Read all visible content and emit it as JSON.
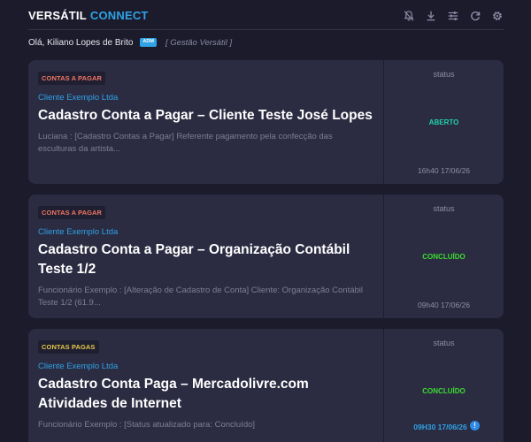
{
  "brand": {
    "part1": "VERSÁTIL",
    "part2": "CONNECT",
    "accent": "#2fa3e6"
  },
  "toolbar": {
    "icons": [
      "bell-off-icon",
      "download-icon",
      "sliders-icon",
      "refresh-icon",
      "gear-icon"
    ]
  },
  "user": {
    "greeting": "Olá, Kiliano Lopes de Brito",
    "role_badge": "ADM",
    "organization": "[ Gestão Versátil ]"
  },
  "cards": [
    {
      "tag": "CONTAS A PAGAR",
      "client": "Cliente Exemplo Ltda",
      "title": "Cadastro Conta a Pagar – Cliente Teste José Lopes",
      "description": "Luciana : [Cadastro Contas a Pagar] Referente pagamento pela confecção das esculturas da artista...",
      "status_label": "status",
      "status": "ABERTO",
      "timestamp": "16h40 17/06/26"
    },
    {
      "tag": "CONTAS A PAGAR",
      "client": "Cliente Exemplo Ltda",
      "title": "Cadastro Conta a Pagar – Organização Contábil Teste 1/2",
      "description": "Funcionário Exemplo : [Alteração de Cadastro de Conta] Cliente: Organização Contábil Teste 1/2 (61.9...",
      "status_label": "status",
      "status": "CONCLUÍDO",
      "timestamp": "09h40 17/06/26"
    },
    {
      "tag": "CONTAS PAGAS",
      "client": "Cliente Exemplo Ltda",
      "title": "Cadastro Conta Paga – Mercadolivre.com Atividades de Internet",
      "description": "Funcionário Exemplo : [Status atualizado para: Concluído]",
      "status_label": "status",
      "status": "CONCLUÍDO",
      "timestamp": "09H30 17/06/26",
      "alert_icon": "!"
    }
  ],
  "colors": {
    "background": "#1b1b2c",
    "card": "#2b2b42",
    "tag_pay": "#ef7563",
    "tag_paid": "#e6c84a",
    "status_open": "#21d3a8",
    "status_done": "#3cdc30"
  }
}
